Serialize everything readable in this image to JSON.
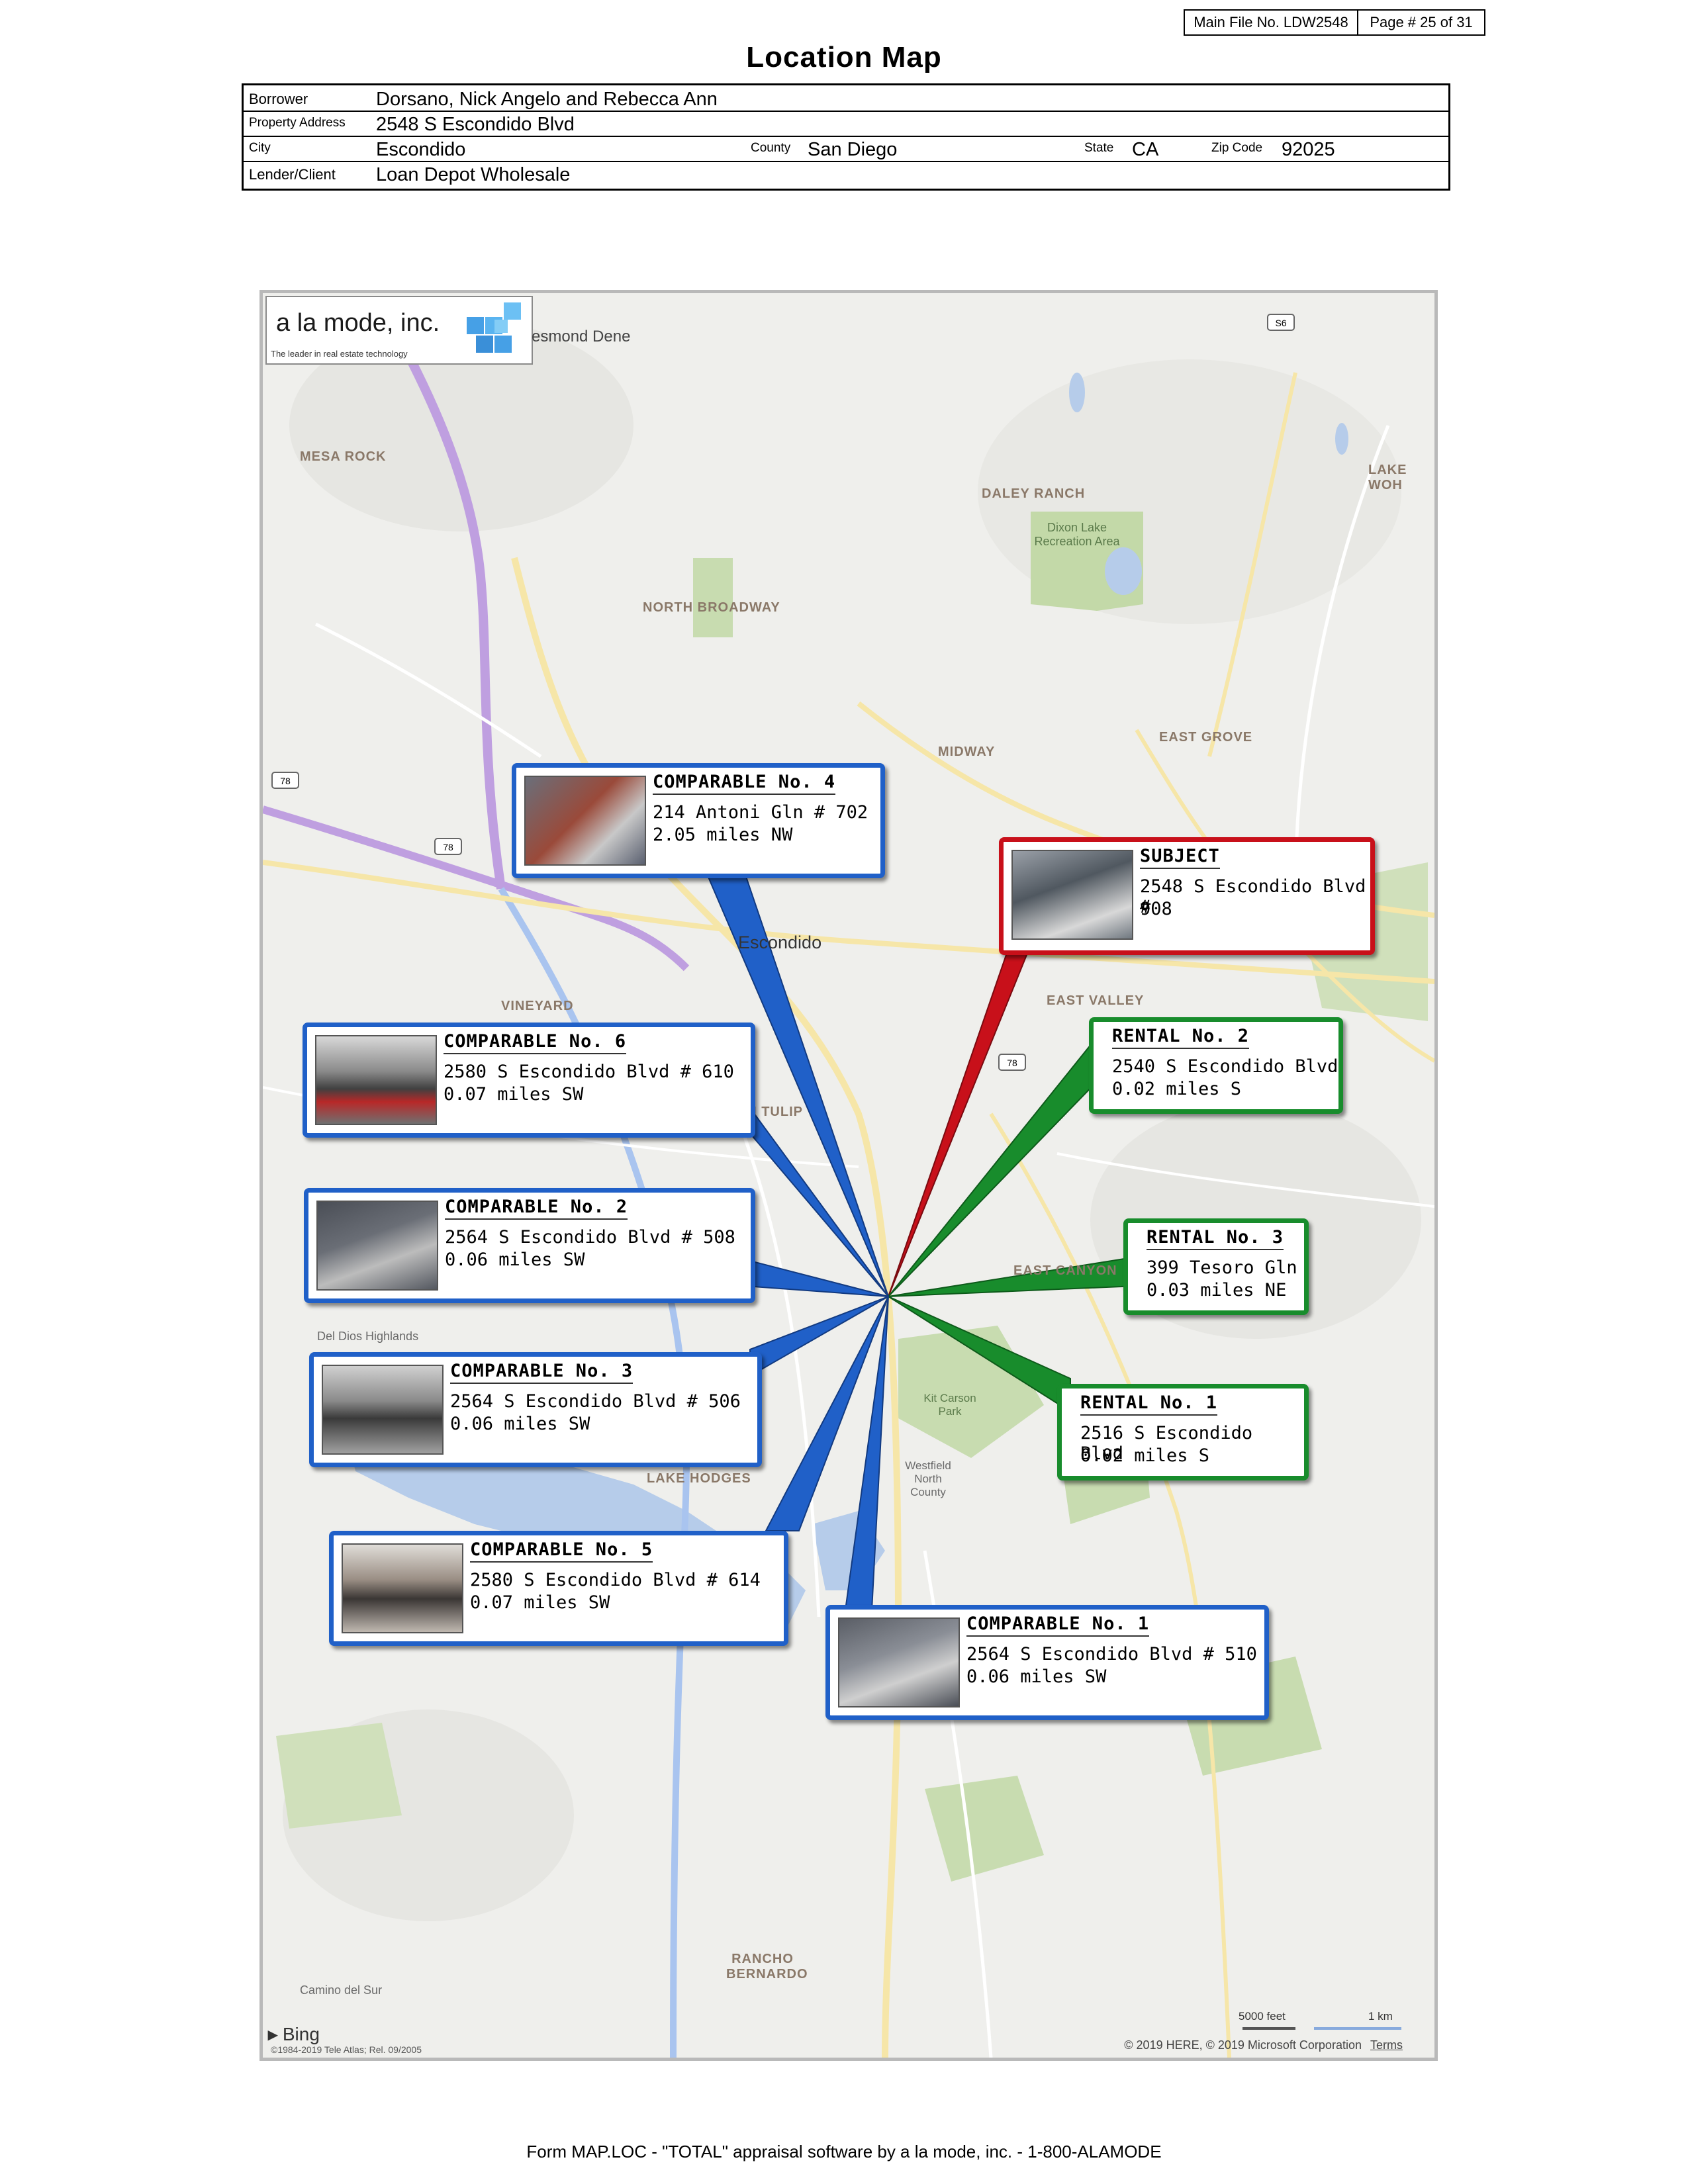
{
  "header": {
    "file_label": "Main File No. LDW2548",
    "page_label": "Page # 25 of 31",
    "title": "Location Map"
  },
  "info": {
    "borrower_label": "Borrower",
    "borrower": "Dorsano, Nick Angelo and Rebecca Ann",
    "property_address_label": "Property Address",
    "property_address": "2548 S Escondido Blvd",
    "city_label": "City",
    "city": "Escondido",
    "county_label": "County",
    "county": "San Diego",
    "state_label": "State",
    "state": "CA",
    "zip_label": "Zip Code",
    "zip": "92025",
    "lender_label": "Lender/Client",
    "lender": "Loan Depot Wholesale"
  },
  "map": {
    "logo_name": "a la mode, inc.",
    "logo_tagline": "The leader in real estate technology",
    "place_labels": [
      "esmond Dene",
      "MESA ROCK",
      "DALEY RANCH",
      "Dixon Lake Recreation Area",
      "NORTH BROADWAY",
      "MIDWAY",
      "EAST GROVE",
      "Escondido",
      "VINEYARD",
      "EAST VALLEY",
      "TH TULIP",
      "EAST CANYON",
      "Del Dios Highlands",
      "Kit Carson Park",
      "Westfield North County",
      "LAKE HODGES",
      "RANCHO BERNARDO",
      "Camino del Sur",
      "LAKE WOH"
    ],
    "callouts": {
      "subject": {
        "head": "SUBJECT",
        "line1": "2548 S Escondido Blvd #",
        "line2": "908"
      },
      "comp4": {
        "head": "COMPARABLE No. 4",
        "line1": "214 Antoni Gln # 702",
        "line2": "2.05 miles NW"
      },
      "comp6": {
        "head": "COMPARABLE No. 6",
        "line1": "2580 S Escondido Blvd # 610",
        "line2": "0.07 miles SW"
      },
      "comp2": {
        "head": "COMPARABLE No. 2",
        "line1": "2564 S Escondido Blvd # 508",
        "line2": "0.06 miles SW"
      },
      "comp3": {
        "head": "COMPARABLE No. 3",
        "line1": "2564 S Escondido Blvd # 506",
        "line2": "0.06 miles SW"
      },
      "comp5": {
        "head": "COMPARABLE No. 5",
        "line1": "2580 S Escondido Blvd # 614",
        "line2": "0.07 miles SW"
      },
      "comp1": {
        "head": "COMPARABLE No. 1",
        "line1": "2564 S Escondido Blvd # 510",
        "line2": "0.06 miles SW"
      },
      "rental2": {
        "head": "RENTAL No. 2",
        "line1": "2540 S Escondido Blvd",
        "line2": "0.02 miles S"
      },
      "rental3": {
        "head": "RENTAL No. 3",
        "line1": "399 Tesoro Gln",
        "line2": "0.03 miles NE"
      },
      "rental1": {
        "head": "RENTAL No. 1",
        "line1": "2516 S Escondido Blvd",
        "line2": "0.02 miles S"
      }
    },
    "bing": "Bing",
    "copyright_left": "©1984-2019 Tele Atlas; Rel. 09/2005",
    "copyright_right": "© 2019 HERE, © 2019 Microsoft Corporation",
    "terms": "Terms",
    "scale_feet": "5000 feet",
    "scale_km": "1 km",
    "colors": {
      "comparable": "#2060c8",
      "subject": "#c8101a",
      "rental": "#188c2c"
    }
  },
  "footer": "Form MAP.LOC - \"TOTAL\" appraisal software by a la mode, inc. - 1-800-ALAMODE"
}
